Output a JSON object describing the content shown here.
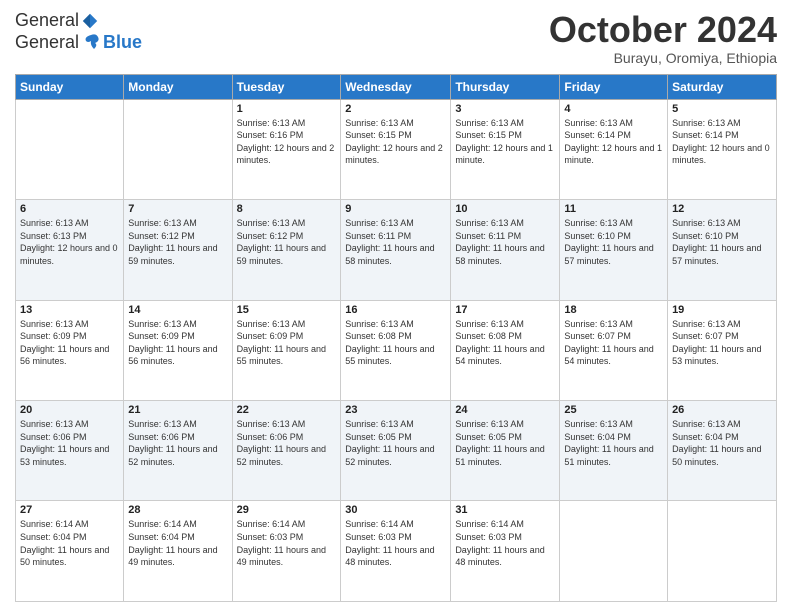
{
  "logo": {
    "general": "General",
    "blue": "Blue",
    "tagline": ""
  },
  "header": {
    "month_year": "October 2024",
    "location": "Burayu, Oromiya, Ethiopia"
  },
  "weekdays": [
    "Sunday",
    "Monday",
    "Tuesday",
    "Wednesday",
    "Thursday",
    "Friday",
    "Saturday"
  ],
  "weeks": [
    [
      {
        "day": "",
        "info": ""
      },
      {
        "day": "",
        "info": ""
      },
      {
        "day": "1",
        "info": "Sunrise: 6:13 AM\nSunset: 6:16 PM\nDaylight: 12 hours and 2 minutes."
      },
      {
        "day": "2",
        "info": "Sunrise: 6:13 AM\nSunset: 6:15 PM\nDaylight: 12 hours and 2 minutes."
      },
      {
        "day": "3",
        "info": "Sunrise: 6:13 AM\nSunset: 6:15 PM\nDaylight: 12 hours and 1 minute."
      },
      {
        "day": "4",
        "info": "Sunrise: 6:13 AM\nSunset: 6:14 PM\nDaylight: 12 hours and 1 minute."
      },
      {
        "day": "5",
        "info": "Sunrise: 6:13 AM\nSunset: 6:14 PM\nDaylight: 12 hours and 0 minutes."
      }
    ],
    [
      {
        "day": "6",
        "info": "Sunrise: 6:13 AM\nSunset: 6:13 PM\nDaylight: 12 hours and 0 minutes."
      },
      {
        "day": "7",
        "info": "Sunrise: 6:13 AM\nSunset: 6:12 PM\nDaylight: 11 hours and 59 minutes."
      },
      {
        "day": "8",
        "info": "Sunrise: 6:13 AM\nSunset: 6:12 PM\nDaylight: 11 hours and 59 minutes."
      },
      {
        "day": "9",
        "info": "Sunrise: 6:13 AM\nSunset: 6:11 PM\nDaylight: 11 hours and 58 minutes."
      },
      {
        "day": "10",
        "info": "Sunrise: 6:13 AM\nSunset: 6:11 PM\nDaylight: 11 hours and 58 minutes."
      },
      {
        "day": "11",
        "info": "Sunrise: 6:13 AM\nSunset: 6:10 PM\nDaylight: 11 hours and 57 minutes."
      },
      {
        "day": "12",
        "info": "Sunrise: 6:13 AM\nSunset: 6:10 PM\nDaylight: 11 hours and 57 minutes."
      }
    ],
    [
      {
        "day": "13",
        "info": "Sunrise: 6:13 AM\nSunset: 6:09 PM\nDaylight: 11 hours and 56 minutes."
      },
      {
        "day": "14",
        "info": "Sunrise: 6:13 AM\nSunset: 6:09 PM\nDaylight: 11 hours and 56 minutes."
      },
      {
        "day": "15",
        "info": "Sunrise: 6:13 AM\nSunset: 6:09 PM\nDaylight: 11 hours and 55 minutes."
      },
      {
        "day": "16",
        "info": "Sunrise: 6:13 AM\nSunset: 6:08 PM\nDaylight: 11 hours and 55 minutes."
      },
      {
        "day": "17",
        "info": "Sunrise: 6:13 AM\nSunset: 6:08 PM\nDaylight: 11 hours and 54 minutes."
      },
      {
        "day": "18",
        "info": "Sunrise: 6:13 AM\nSunset: 6:07 PM\nDaylight: 11 hours and 54 minutes."
      },
      {
        "day": "19",
        "info": "Sunrise: 6:13 AM\nSunset: 6:07 PM\nDaylight: 11 hours and 53 minutes."
      }
    ],
    [
      {
        "day": "20",
        "info": "Sunrise: 6:13 AM\nSunset: 6:06 PM\nDaylight: 11 hours and 53 minutes."
      },
      {
        "day": "21",
        "info": "Sunrise: 6:13 AM\nSunset: 6:06 PM\nDaylight: 11 hours and 52 minutes."
      },
      {
        "day": "22",
        "info": "Sunrise: 6:13 AM\nSunset: 6:06 PM\nDaylight: 11 hours and 52 minutes."
      },
      {
        "day": "23",
        "info": "Sunrise: 6:13 AM\nSunset: 6:05 PM\nDaylight: 11 hours and 52 minutes."
      },
      {
        "day": "24",
        "info": "Sunrise: 6:13 AM\nSunset: 6:05 PM\nDaylight: 11 hours and 51 minutes."
      },
      {
        "day": "25",
        "info": "Sunrise: 6:13 AM\nSunset: 6:04 PM\nDaylight: 11 hours and 51 minutes."
      },
      {
        "day": "26",
        "info": "Sunrise: 6:13 AM\nSunset: 6:04 PM\nDaylight: 11 hours and 50 minutes."
      }
    ],
    [
      {
        "day": "27",
        "info": "Sunrise: 6:14 AM\nSunset: 6:04 PM\nDaylight: 11 hours and 50 minutes."
      },
      {
        "day": "28",
        "info": "Sunrise: 6:14 AM\nSunset: 6:04 PM\nDaylight: 11 hours and 49 minutes."
      },
      {
        "day": "29",
        "info": "Sunrise: 6:14 AM\nSunset: 6:03 PM\nDaylight: 11 hours and 49 minutes."
      },
      {
        "day": "30",
        "info": "Sunrise: 6:14 AM\nSunset: 6:03 PM\nDaylight: 11 hours and 48 minutes."
      },
      {
        "day": "31",
        "info": "Sunrise: 6:14 AM\nSunset: 6:03 PM\nDaylight: 11 hours and 48 minutes."
      },
      {
        "day": "",
        "info": ""
      },
      {
        "day": "",
        "info": ""
      }
    ]
  ]
}
